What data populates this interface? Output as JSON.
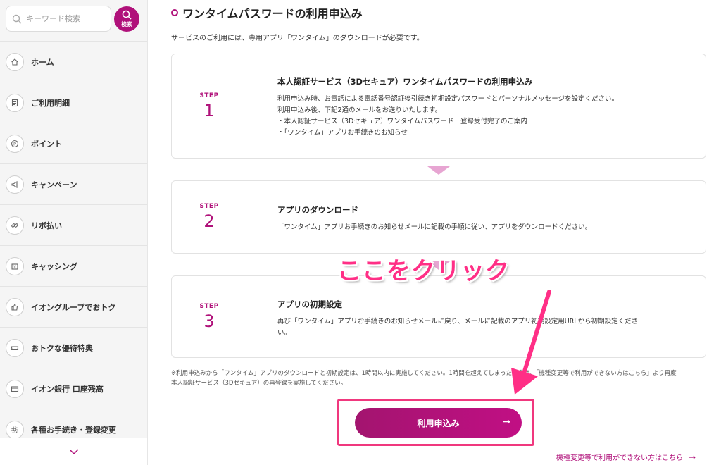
{
  "sidebar": {
    "search": {
      "placeholder": "キーワード検索",
      "button_label": "検索"
    },
    "items": [
      {
        "label": "ホーム",
        "icon": "home-icon"
      },
      {
        "label": "ご利用明細",
        "icon": "document-icon"
      },
      {
        "label": "ポイント",
        "icon": "points-icon"
      },
      {
        "label": "キャンペーン",
        "icon": "megaphone-icon"
      },
      {
        "label": "リボ払い",
        "icon": "link-icon"
      },
      {
        "label": "キャッシング",
        "icon": "wallet-icon"
      },
      {
        "label": "イオングループでおトク",
        "icon": "thumbs-up-icon"
      },
      {
        "label": "おトクな優待特典",
        "icon": "ticket-icon"
      },
      {
        "label": "イオン銀行 口座残高",
        "icon": "bank-card-icon"
      },
      {
        "label": "各種お手続き・登録変更",
        "icon": "gear-icon"
      }
    ]
  },
  "main": {
    "title": "ワンタイムパスワードの利用申込み",
    "intro": "サービスのご利用には、専用アプリ「ワンタイム」のダウンロードが必要です。",
    "step_word": "STEP",
    "steps": [
      {
        "number": "1",
        "title": "本人認証サービス（3Dセキュア）ワンタイムパスワードの利用申込み",
        "lines": [
          "利用申込み時、お電話による電話番号認証後引続き初期設定パスワードとパーソナルメッセージを設定ください。",
          "利用申込み後、下記2通のメールをお送りいたします。",
          "・本人認証サービス（3Dセキュア）ワンタイムパスワード　登録受付完了のご案内",
          "・「ワンタイム」アプリお手続きのお知らせ"
        ]
      },
      {
        "number": "2",
        "title": "アプリのダウンロード",
        "lines": [
          "「ワンタイム」アプリお手続きのお知らせメールに記載の手順に従い、アプリをダウンロードください。"
        ]
      },
      {
        "number": "3",
        "title": "アプリの初期設定",
        "lines": [
          "再び「ワンタイム」アプリお手続きのお知らせメールに戻り、メールに記載のアプリ初期設定用URLから初期設定くださ",
          "い。"
        ]
      }
    ],
    "note_lines": [
      "※利用申込みから「ワンタイム」アプリのダウンロードと初期設定は、1時間以内に実施してください。1時間を超えてしまった場合は、「機種変更等で利用ができない方はこちら」より再度",
      "本人認証サービス（3Dセキュア）の再登録を実施してください。"
    ],
    "apply_button": "利用申込み",
    "apply_arrow": "→",
    "footer_link": "機種変更等で利用ができない方はこちら",
    "footer_arrow": "→"
  },
  "annotation": {
    "callout": "ここをクリック",
    "color": "#ff2f86"
  },
  "colors": {
    "brand": "#b0117a",
    "step_arrow": "#e7a5d2"
  }
}
